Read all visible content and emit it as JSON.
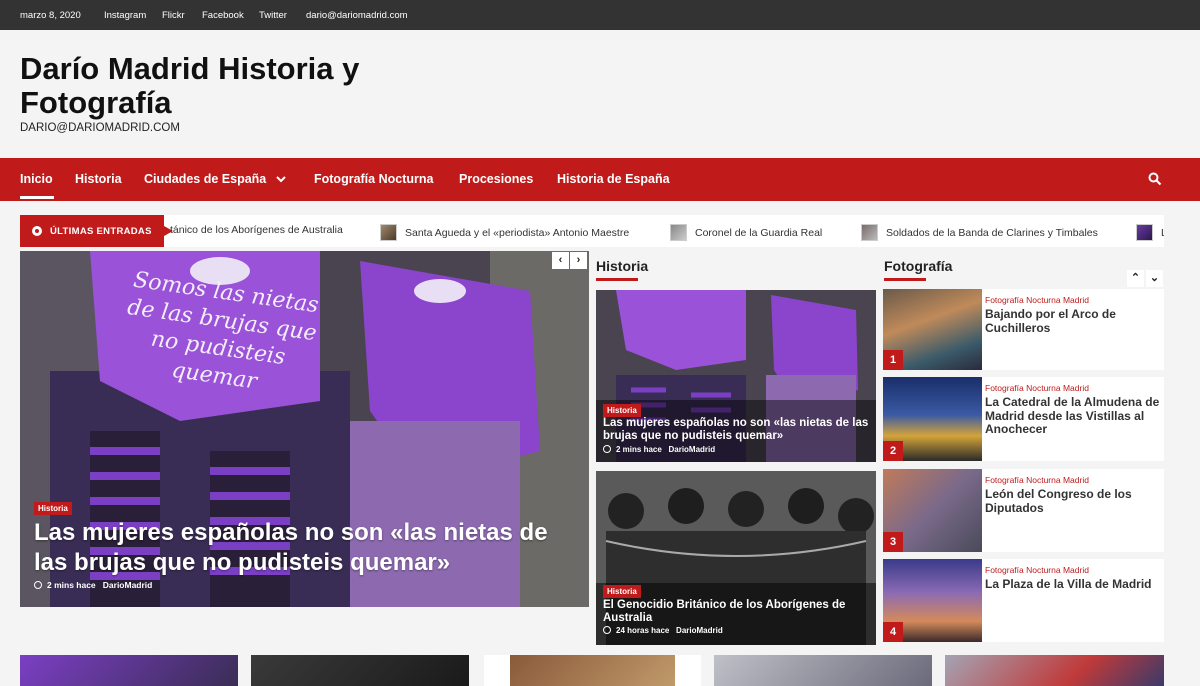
{
  "topbar": {
    "date": "marzo 8, 2020",
    "links": [
      "Instagram",
      "Flickr",
      "Facebook",
      "Twitter",
      "dario@dariomadrid.com"
    ]
  },
  "site": {
    "title": "Darío Madrid Historia y Fotografía",
    "description": "DARIO@DARIOMADRID.COM"
  },
  "nav": {
    "items": [
      "Inicio",
      "Historia",
      "Ciudades de España",
      "Fotografía Nocturna",
      "Procesiones",
      "Historia de España"
    ],
    "active": "Inicio"
  },
  "ticker": {
    "label": "ÚLTIMAS ENTRADAS",
    "items": [
      "tánico de los Aborígenes de Australia",
      "Santa Agueda y el «periodista» Antonio Maestre",
      "Coronel de la Guardia Real",
      "Soldados de la Banda de Clarines y Timbales",
      "L"
    ]
  },
  "hero": {
    "category": "Historia",
    "title": "Las mujeres españolas no son «las nietas de las brujas que no pudisteis quemar»",
    "time": "2 mins hace",
    "author": "DarioMadrid",
    "sign_text": "Somos las nietas de las brujas que no pudisteis quemar"
  },
  "historia": {
    "section_title": "Historia",
    "cards": [
      {
        "category": "Historia",
        "title": "Las mujeres españolas no son «las nietas de las brujas que no pudisteis quemar»",
        "time": "2 mins hace",
        "author": "DarioMadrid"
      },
      {
        "category": "Historia",
        "title": "El Genocidio Británico de los Aborígenes de Australia",
        "time": "24 horas hace",
        "author": "DarioMadrid"
      }
    ]
  },
  "fotografia": {
    "section_title": "Fotografía",
    "items": [
      {
        "num": "1",
        "category": "Fotografía Nocturna Madrid",
        "title": "Bajando por el Arco de Cuchilleros"
      },
      {
        "num": "2",
        "category": "Fotografía Nocturna Madrid",
        "title": "La Catedral de la Almudena de Madrid desde las Vistillas al Anochecer"
      },
      {
        "num": "3",
        "category": "Fotografía Nocturna Madrid",
        "title": "León del Congreso de los Diputados"
      },
      {
        "num": "4",
        "category": "Fotografía Nocturna Madrid",
        "title": "La Plaza de la Villa de Madrid"
      }
    ]
  },
  "colors": {
    "accent": "#c01a1a",
    "topbar": "#333333",
    "purple": "#7b3fc4"
  }
}
